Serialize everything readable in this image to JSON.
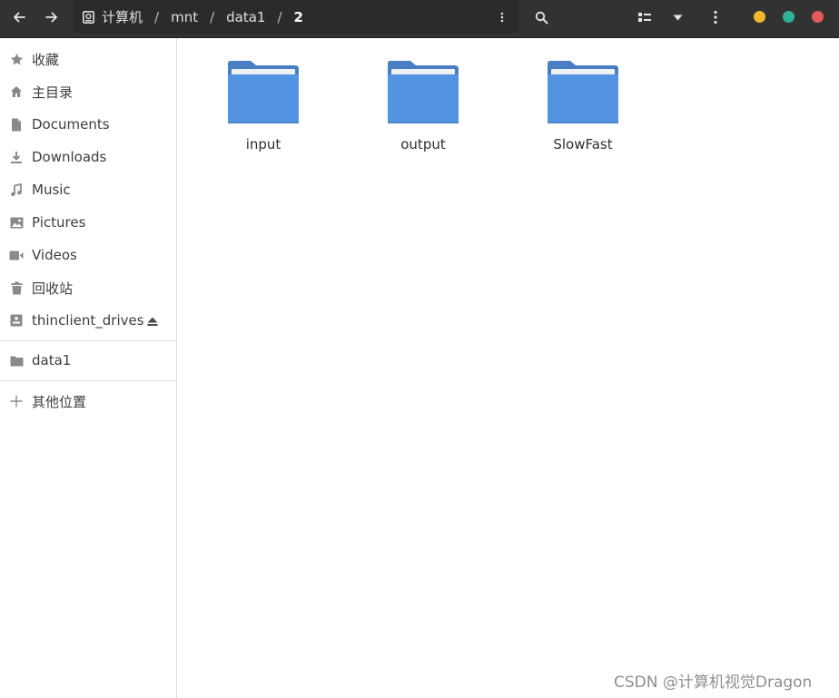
{
  "header": {
    "breadcrumb": [
      {
        "label": "计算机",
        "icon": "drive-icon"
      },
      {
        "label": "mnt"
      },
      {
        "label": "data1"
      },
      {
        "label": "2",
        "current": true
      }
    ],
    "separator": "/",
    "window_controls": {
      "minimize_color": "#f2b82d",
      "maximize_color": "#2eb398",
      "close_color": "#e45a5a"
    }
  },
  "sidebar": {
    "places": [
      {
        "label": "收藏",
        "icon": "star-icon"
      },
      {
        "label": "主目录",
        "icon": "home-icon"
      },
      {
        "label": "Documents",
        "icon": "document-icon"
      },
      {
        "label": "Downloads",
        "icon": "download-icon"
      },
      {
        "label": "Music",
        "icon": "music-icon"
      },
      {
        "label": "Pictures",
        "icon": "picture-icon"
      },
      {
        "label": "Videos",
        "icon": "video-icon"
      },
      {
        "label": "回收站",
        "icon": "trash-icon"
      },
      {
        "label": "thinclient_drives",
        "icon": "drive-icon",
        "ejectable": true
      }
    ],
    "bookmarks": [
      {
        "label": "data1",
        "icon": "folder-icon"
      }
    ],
    "other": {
      "label": "其他位置",
      "icon": "plus-icon"
    }
  },
  "content": {
    "folders": [
      {
        "name": "input"
      },
      {
        "name": "output"
      },
      {
        "name": "SlowFast"
      }
    ],
    "folder_color": "#5294e2"
  },
  "watermark": "CSDN @计算机视觉Dragon"
}
